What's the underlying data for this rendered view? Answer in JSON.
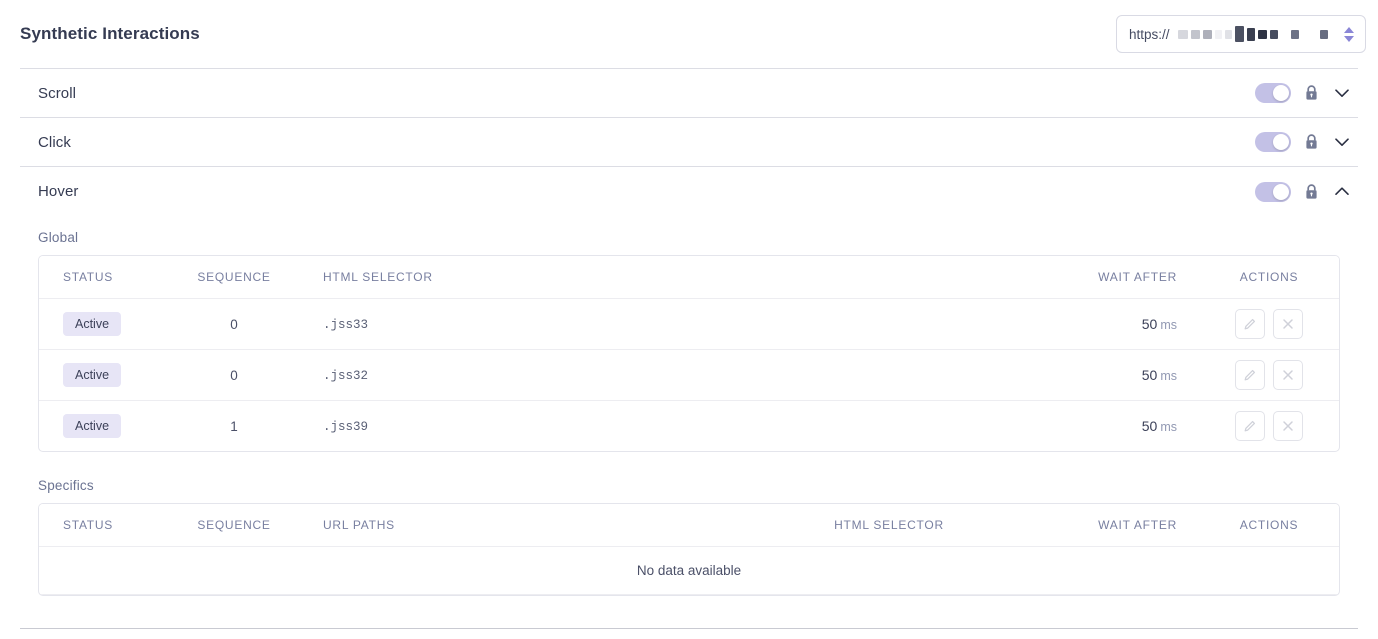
{
  "header": {
    "title": "Synthetic Interactions",
    "url_select": {
      "scheme_label": "https://",
      "value_redacted": true,
      "redaction_blocks": [
        {
          "width": 10,
          "color": "#d6d7dd"
        },
        {
          "width": 9,
          "color": "#c2c4cc"
        },
        {
          "width": 9,
          "color": "#aeb0ba"
        },
        {
          "width": 7,
          "color": "#f1f1f4"
        },
        {
          "width": 7,
          "color": "#e0e1e6"
        },
        {
          "width": 9,
          "color": "#4c5162"
        },
        {
          "width": 8,
          "color": "#3a3f50"
        },
        {
          "width": 9,
          "color": "#2f3444"
        },
        {
          "width": 8,
          "color": "#474d5f"
        },
        {
          "width": 8,
          "color": "#6d7286"
        },
        {
          "width": 8,
          "color": "#676c80"
        }
      ],
      "stepper_icon": "chevron-up-down-icon"
    }
  },
  "accordion": {
    "items": [
      {
        "label": "Scroll",
        "enabled": true,
        "locked": true,
        "expanded": false,
        "toggle_icon": "toggle-on-icon",
        "lock_icon": "lock-icon",
        "chevron_icon": "chevron-down-icon"
      },
      {
        "label": "Click",
        "enabled": true,
        "locked": true,
        "expanded": false,
        "toggle_icon": "toggle-on-icon",
        "lock_icon": "lock-icon",
        "chevron_icon": "chevron-down-icon"
      },
      {
        "label": "Hover",
        "enabled": true,
        "locked": true,
        "expanded": true,
        "toggle_icon": "toggle-on-icon",
        "lock_icon": "lock-icon",
        "chevron_icon": "chevron-up-icon"
      }
    ]
  },
  "hover_panel": {
    "global": {
      "section_label": "Global",
      "columns": [
        "STATUS",
        "SEQUENCE",
        "HTML SELECTOR",
        "WAIT AFTER",
        "ACTIONS"
      ],
      "rows": [
        {
          "status": "Active",
          "sequence": "0",
          "html_selector": ".jss33",
          "wait_after_value": "50",
          "wait_after_unit": "ms",
          "edit_icon": "pencil-icon",
          "delete_icon": "close-icon"
        },
        {
          "status": "Active",
          "sequence": "0",
          "html_selector": ".jss32",
          "wait_after_value": "50",
          "wait_after_unit": "ms",
          "edit_icon": "pencil-icon",
          "delete_icon": "close-icon"
        },
        {
          "status": "Active",
          "sequence": "1",
          "html_selector": ".jss39",
          "wait_after_value": "50",
          "wait_after_unit": "ms",
          "edit_icon": "pencil-icon",
          "delete_icon": "close-icon"
        }
      ]
    },
    "specifics": {
      "section_label": "Specifics",
      "columns": [
        "STATUS",
        "SEQUENCE",
        "URL PATHS",
        "HTML SELECTOR",
        "WAIT AFTER",
        "ACTIONS"
      ],
      "empty_message": "No data available",
      "rows": []
    }
  },
  "colors": {
    "accent_toggle": "#c3c1e6",
    "badge_background": "#e7e5f6",
    "badge_text": "#3c4159",
    "title_text": "#353b52",
    "section_label_text": "#6b7392",
    "table_header_text": "#787fa0",
    "border": "#e4e5ec",
    "divider": "#dcdde4",
    "stepper_arrow": "#8a86d6",
    "lock_icon": "#737a94"
  }
}
